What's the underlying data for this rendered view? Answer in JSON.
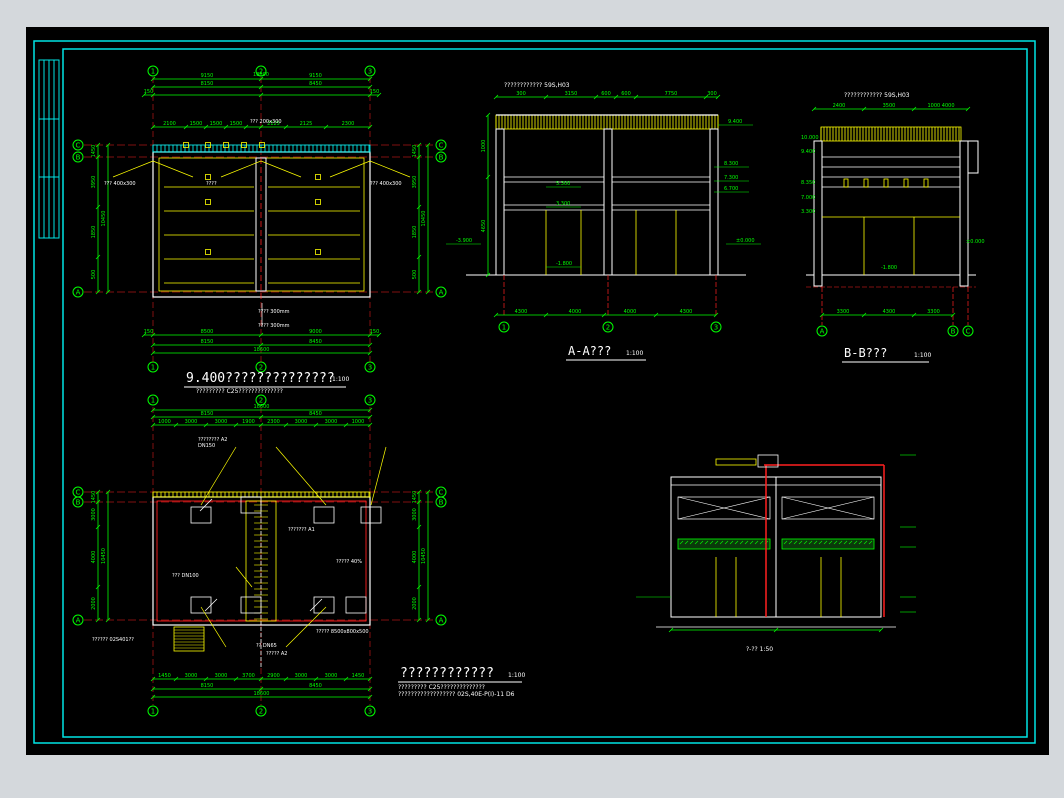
{
  "sheet": {
    "colors": {
      "background": "#000000",
      "frame": "#00e5e5",
      "wall": "#ffffff",
      "dim": "#00ff00",
      "hatch": "#ffff00",
      "axis": "#ff2020",
      "text": "#ffffff"
    }
  },
  "plan_top": {
    "title": "9.400??????????????",
    "scale": "1:100",
    "subtitle": "????????? C25??????????????",
    "grid_x": [
      "1",
      "2",
      "3"
    ],
    "grid_y": [
      "A",
      "B",
      "C"
    ],
    "dims_top": [
      "9150",
      "9150"
    ],
    "dims_top2": [
      "8150",
      "8450"
    ],
    "total": "18600",
    "dims_bottom": [
      "8500",
      "9000"
    ],
    "dims_bottom2": [
      "8150",
      "8450"
    ],
    "dims_left": [
      "1450",
      "3950",
      "1850",
      "500"
    ],
    "notes": [
      "??? 200x300",
      "??? 400x300",
      "??? 400x300",
      "???? 300mm",
      "????"
    ]
  },
  "section_aa": {
    "title": "A-A???",
    "scale": "1:100",
    "top_note": "????????????   59S,H03",
    "dims": [
      "4300",
      "4000",
      "4000",
      "4300"
    ],
    "grid_x": [
      "1",
      "2",
      "3"
    ],
    "levels": [
      "9.400",
      "8.300",
      "7.300",
      "6.700",
      "5.300",
      "3.300",
      "±0.000",
      "-1.800",
      "-3.900"
    ]
  },
  "section_bb": {
    "title": "B-B???",
    "scale": "1:100",
    "top_note": "????????????   59S,H03",
    "dims": [
      "3300",
      "4300",
      "3300"
    ],
    "grid_x": [
      "A",
      "B",
      "C"
    ],
    "levels": [
      "10.000",
      "9.400",
      "8.350",
      "7.000",
      "3.300",
      "±0.000",
      "-1.800"
    ]
  },
  "plan_bottom": {
    "title": "????????????",
    "scale": "1:100",
    "subtitle": "????????? C25??????????????",
    "subtitle2": "??????????????????    02S,40E-P(I)-11 D6",
    "grid_x": [
      "1",
      "2",
      "3"
    ],
    "grid_y": [
      "A",
      "B",
      "C"
    ],
    "total": "18600",
    "dims_top": [
      "8150",
      "8450"
    ],
    "dims_bottom": [
      "8150",
      "8450"
    ],
    "notes": [
      "???????? A2",
      "DN150",
      "??????? A1",
      "????? 40%",
      "??? DN100",
      "????? A2",
      "????? 8500x800x500",
      "?? DN65",
      "?????? 02S401??"
    ]
  },
  "pipe_section": {
    "title": "?-?? 1:50"
  }
}
